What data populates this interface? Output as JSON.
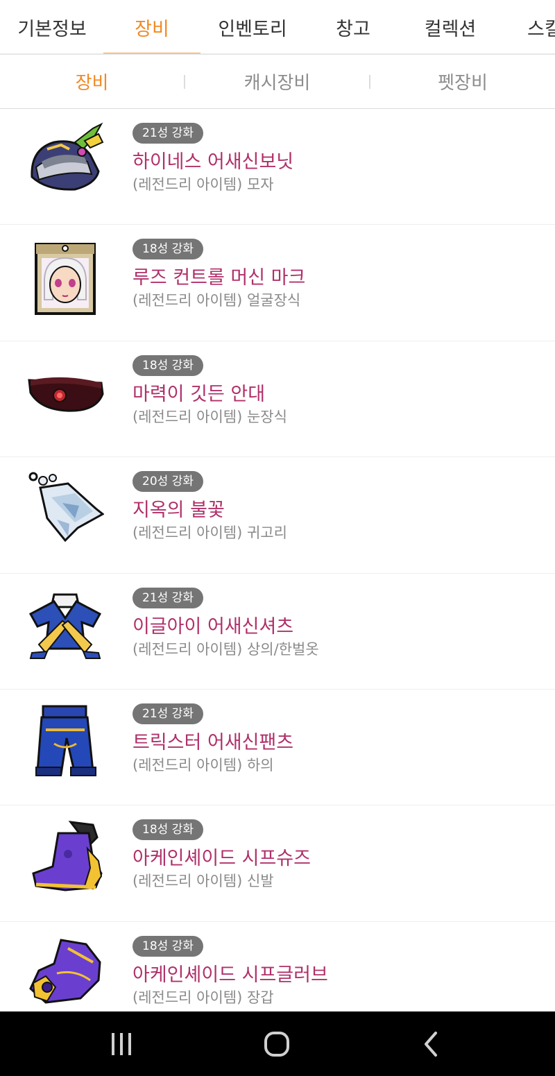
{
  "top_tabs": [
    "기본정보",
    "장비",
    "인벤토리",
    "창고",
    "컬렉션",
    "스킬"
  ],
  "sub_tabs": [
    "장비",
    "캐시장비",
    "펫장비"
  ],
  "items": [
    {
      "badge": "21성 강화",
      "name": "하이네스 어새신보닛",
      "type": "(레전드리 아이템) 모자",
      "icon": "hat-icon"
    },
    {
      "badge": "18성 강화",
      "name": "루즈 컨트롤 머신 마크",
      "type": "(레전드리 아이템) 얼굴장식",
      "icon": "face-accessory-icon"
    },
    {
      "badge": "18성 강화",
      "name": "마력이 깃든 안대",
      "type": "(레전드리 아이템) 눈장식",
      "icon": "eye-patch-icon"
    },
    {
      "badge": "20성 강화",
      "name": "지옥의 불꽃",
      "type": "(레전드리 아이템) 귀고리",
      "icon": "earring-icon"
    },
    {
      "badge": "21성 강화",
      "name": "이글아이 어새신셔츠",
      "type": "(레전드리 아이템) 상의/한벌옷",
      "icon": "shirt-icon"
    },
    {
      "badge": "21성 강화",
      "name": "트릭스터 어새신팬츠",
      "type": "(레전드리 아이템) 하의",
      "icon": "pants-icon"
    },
    {
      "badge": "18성 강화",
      "name": "아케인셰이드 시프슈즈",
      "type": "(레전드리 아이템) 신발",
      "icon": "shoes-icon"
    },
    {
      "badge": "18성 강화",
      "name": "아케인셰이드 시프글러브",
      "type": "(레전드리 아이템) 장갑",
      "icon": "gloves-icon"
    }
  ],
  "nav": {
    "recent": "recent-apps-icon",
    "home": "home-icon",
    "back": "back-icon"
  },
  "colors": {
    "accent": "#f08a24",
    "item_name": "#b0306a",
    "badge_bg": "#757575"
  }
}
